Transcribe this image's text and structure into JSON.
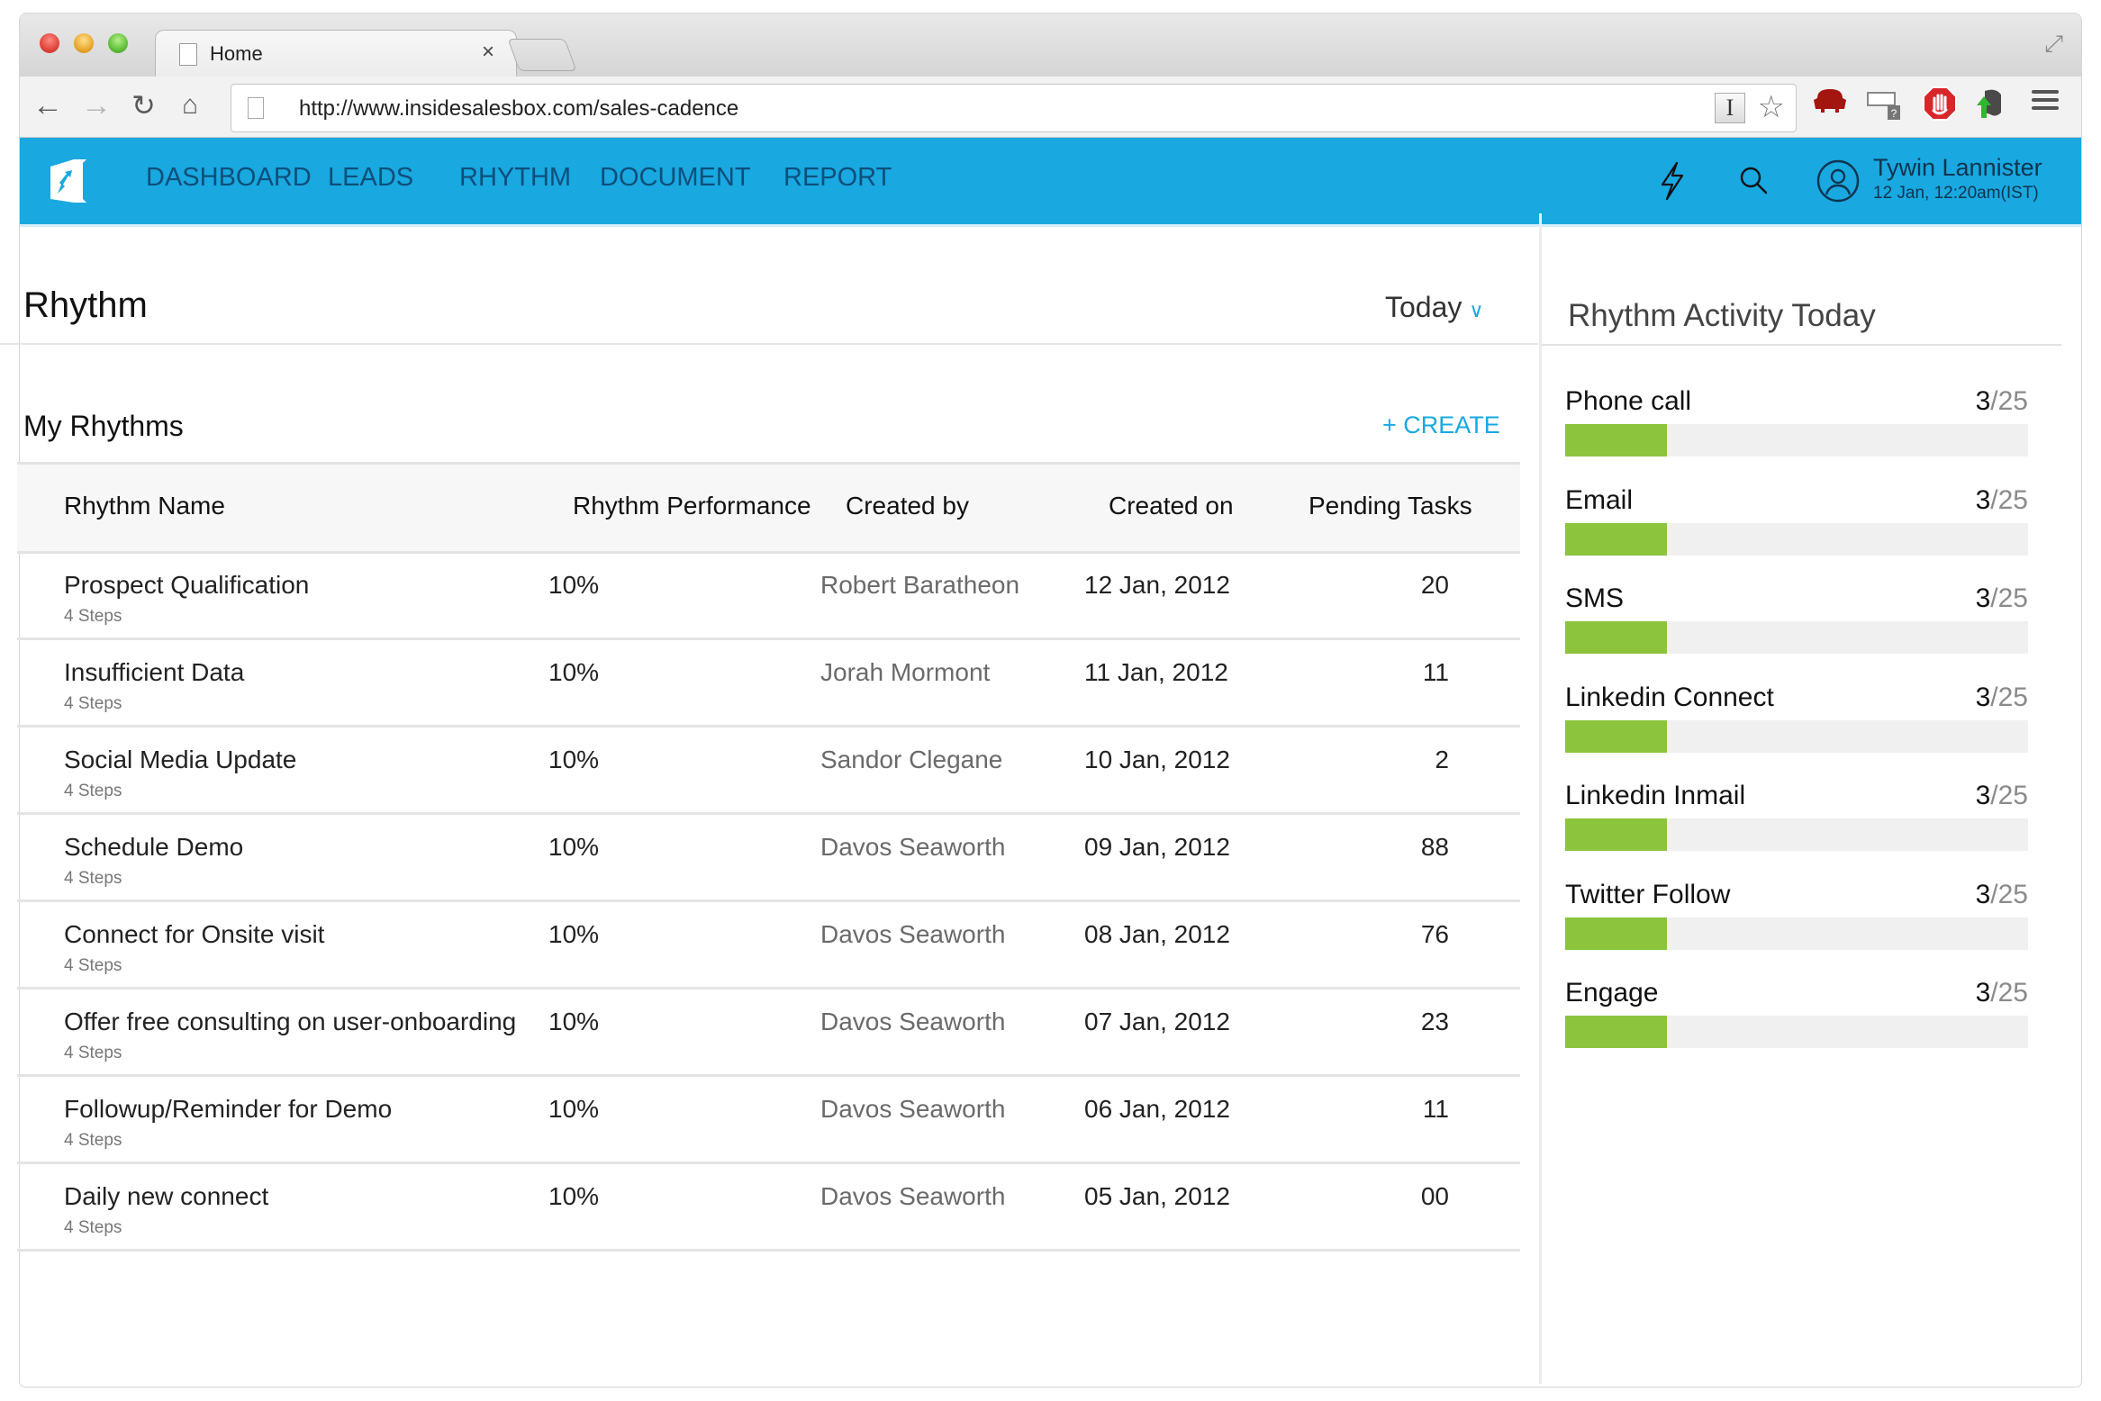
{
  "browser": {
    "tab_title": "Home",
    "url": "http://www.insidesalesbox.com/sales-cadence",
    "nav_icons": [
      "back-arrow-icon",
      "forward-arrow-icon",
      "reload-icon",
      "home-icon"
    ],
    "extensions": [
      "readability-icon",
      "resize-window-icon",
      "adblock-icon",
      "evernote-icon",
      "menu-icon"
    ]
  },
  "app": {
    "brand_color": "#19a8e0",
    "nav": [
      "DASHBOARD",
      "LEADS",
      "RHYTHM",
      "DOCUMENT",
      "REPORT"
    ],
    "user": {
      "name": "Tywin Lannister",
      "datetime": "12 Jan, 12:20am(IST)"
    }
  },
  "main": {
    "title": "Rhythm",
    "range": "Today",
    "section_title": "My Rhythms",
    "create_label": "+ CREATE",
    "columns": [
      "Rhythm Name",
      "Rhythm Performance",
      "Created by",
      "Created on",
      "Pending Tasks"
    ],
    "rows": [
      {
        "name": "Prospect Qualification",
        "steps": "4 Steps",
        "performance": "10%",
        "created_by": "Robert Baratheon",
        "created_on": "12 Jan, 2012",
        "pending": "20"
      },
      {
        "name": "Insufficient Data",
        "steps": "4 Steps",
        "performance": "10%",
        "created_by": "Jorah Mormont",
        "created_on": "11 Jan, 2012",
        "pending": "11"
      },
      {
        "name": "Social Media Update",
        "steps": "4 Steps",
        "performance": "10%",
        "created_by": "Sandor Clegane",
        "created_on": "10 Jan, 2012",
        "pending": "2"
      },
      {
        "name": "Schedule Demo",
        "steps": "4 Steps",
        "performance": "10%",
        "created_by": "Davos Seaworth",
        "created_on": "09 Jan, 2012",
        "pending": "88"
      },
      {
        "name": "Connect for Onsite visit",
        "steps": "4 Steps",
        "performance": "10%",
        "created_by": "Davos Seaworth",
        "created_on": "08 Jan, 2012",
        "pending": "76"
      },
      {
        "name": "Offer free consulting on user-onboarding",
        "steps": "4 Steps",
        "performance": "10%",
        "created_by": "Davos Seaworth",
        "created_on": "07 Jan, 2012",
        "pending": "23"
      },
      {
        "name": "Followup/Reminder for Demo",
        "steps": "4 Steps",
        "performance": "10%",
        "created_by": "Davos Seaworth",
        "created_on": "06 Jan, 2012",
        "pending": "11"
      },
      {
        "name": "Daily new connect",
        "steps": "4 Steps",
        "performance": "10%",
        "created_by": "Davos Seaworth",
        "created_on": "05 Jan, 2012",
        "pending": "00"
      }
    ]
  },
  "side": {
    "title": "Rhythm Activity Today",
    "bar_color": "#8cc43e",
    "activities": [
      {
        "label": "Phone call",
        "done": "3",
        "total": "/25",
        "fill_fraction": 0.22
      },
      {
        "label": "Email",
        "done": "3",
        "total": "/25",
        "fill_fraction": 0.22
      },
      {
        "label": "SMS",
        "done": "3",
        "total": "/25",
        "fill_fraction": 0.22
      },
      {
        "label": "Linkedin Connect",
        "done": "3",
        "total": "/25",
        "fill_fraction": 0.22
      },
      {
        "label": "Linkedin Inmail",
        "done": "3",
        "total": "/25",
        "fill_fraction": 0.22
      },
      {
        "label": "Twitter Follow",
        "done": "3",
        "total": "/25",
        "fill_fraction": 0.22
      },
      {
        "label": "Engage",
        "done": "3",
        "total": "/25",
        "fill_fraction": 0.22
      }
    ]
  }
}
